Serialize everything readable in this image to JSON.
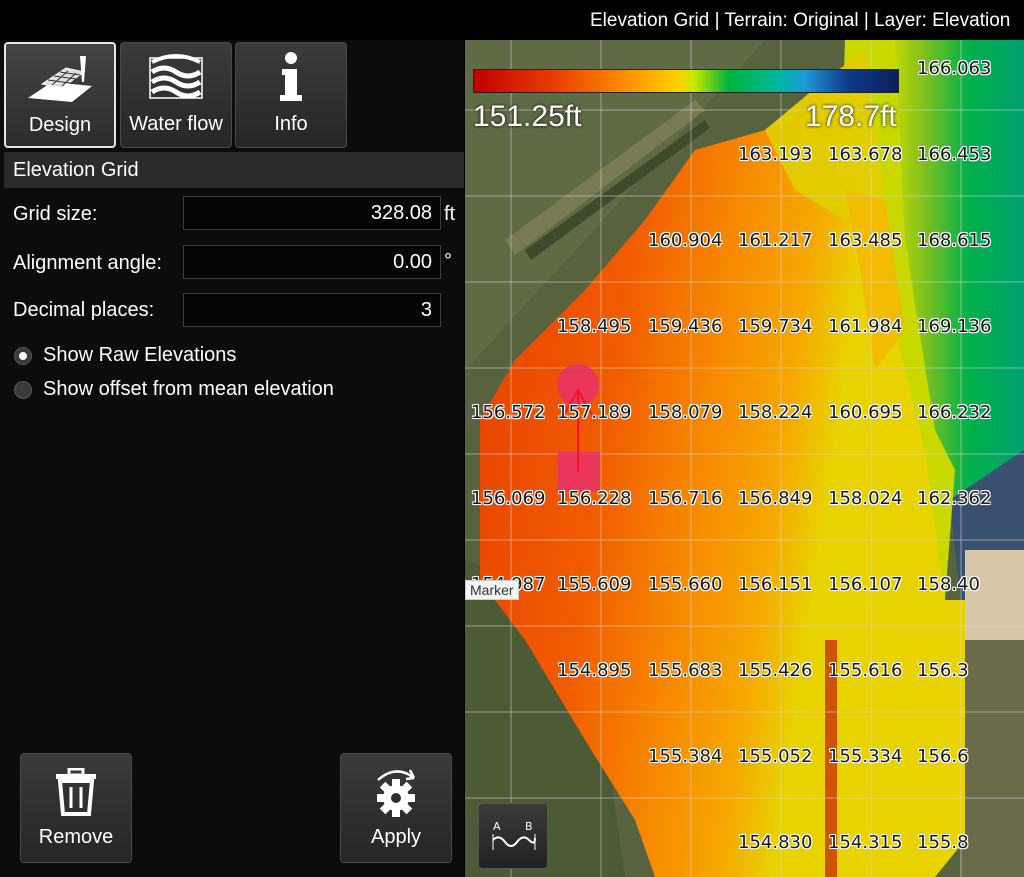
{
  "titlebar": {
    "title": "Elevation Grid | Terrain: Original | Layer: Elevation"
  },
  "tabs": [
    {
      "label": "Design",
      "icon": "design-icon",
      "active": true
    },
    {
      "label": "Water flow",
      "icon": "water-flow-icon",
      "active": false
    },
    {
      "label": "Info",
      "icon": "info-icon",
      "active": false
    }
  ],
  "section": {
    "title": "Elevation Grid"
  },
  "fields": {
    "grid_size": {
      "label": "Grid size:",
      "value": "328.08",
      "unit": "ft"
    },
    "alignment_angle": {
      "label": "Alignment angle:",
      "value": "0.00",
      "unit": "°"
    },
    "decimal_places": {
      "label": "Decimal places:",
      "value": "3"
    }
  },
  "options": {
    "raw": {
      "label": "Show Raw Elevations",
      "selected": true
    },
    "offset": {
      "label": "Show offset from mean elevation",
      "selected": false
    }
  },
  "buttons": {
    "remove": "Remove",
    "apply": "Apply"
  },
  "legend": {
    "min": "151.25ft",
    "max": "178.7ft"
  },
  "map": {
    "marker_label": "Marker",
    "elevation_labels": [
      {
        "text": "166.063",
        "row": 0,
        "col": 5
      },
      {
        "text": "163.193",
        "row": 1,
        "col": 3
      },
      {
        "text": "163.678",
        "row": 1,
        "col": 4
      },
      {
        "text": "166.453",
        "row": 1,
        "col": 5
      },
      {
        "text": "160.904",
        "row": 2,
        "col": 2
      },
      {
        "text": "161.217",
        "row": 2,
        "col": 3
      },
      {
        "text": "163.485",
        "row": 2,
        "col": 4
      },
      {
        "text": "168.615",
        "row": 2,
        "col": 5
      },
      {
        "text": "158.495",
        "row": 3,
        "col": 1
      },
      {
        "text": "159.436",
        "row": 3,
        "col": 2
      },
      {
        "text": "159.734",
        "row": 3,
        "col": 3
      },
      {
        "text": "161.984",
        "row": 3,
        "col": 4
      },
      {
        "text": "169.136",
        "row": 3,
        "col": 5
      },
      {
        "text": "156.572",
        "row": 4,
        "col": 0
      },
      {
        "text": "157.189",
        "row": 4,
        "col": 1
      },
      {
        "text": "158.079",
        "row": 4,
        "col": 2
      },
      {
        "text": "158.224",
        "row": 4,
        "col": 3
      },
      {
        "text": "160.695",
        "row": 4,
        "col": 4
      },
      {
        "text": "166.232",
        "row": 4,
        "col": 5
      },
      {
        "text": "156.069",
        "row": 5,
        "col": 0
      },
      {
        "text": "156.228",
        "row": 5,
        "col": 1
      },
      {
        "text": "156.716",
        "row": 5,
        "col": 2
      },
      {
        "text": "156.849",
        "row": 5,
        "col": 3
      },
      {
        "text": "158.024",
        "row": 5,
        "col": 4
      },
      {
        "text": "162.362",
        "row": 5,
        "col": 5
      },
      {
        "text": "154.987",
        "row": 6,
        "col": 0
      },
      {
        "text": "155.609",
        "row": 6,
        "col": 1
      },
      {
        "text": "155.660",
        "row": 6,
        "col": 2
      },
      {
        "text": "156.151",
        "row": 6,
        "col": 3
      },
      {
        "text": "156.107",
        "row": 6,
        "col": 4
      },
      {
        "text": "158.40",
        "row": 6,
        "col": 5
      },
      {
        "text": "154.895",
        "row": 7,
        "col": 1
      },
      {
        "text": "155.683",
        "row": 7,
        "col": 2
      },
      {
        "text": "155.426",
        "row": 7,
        "col": 3
      },
      {
        "text": "155.616",
        "row": 7,
        "col": 4
      },
      {
        "text": "156.3",
        "row": 7,
        "col": 5
      },
      {
        "text": "155.384",
        "row": 8,
        "col": 2
      },
      {
        "text": "155.052",
        "row": 8,
        "col": 3
      },
      {
        "text": "155.334",
        "row": 8,
        "col": 4
      },
      {
        "text": "156.6",
        "row": 8,
        "col": 5
      },
      {
        "text": "154.830",
        "row": 9,
        "col": 3
      },
      {
        "text": "154.315",
        "row": 9,
        "col": 4
      },
      {
        "text": "155.8",
        "row": 9,
        "col": 5
      }
    ]
  },
  "icons": {
    "design": "design-icon",
    "water_flow": "water-flow-icon",
    "info": "info-icon",
    "remove": "trash-icon",
    "apply": "gear-refresh-icon",
    "profile": "ab-profile-icon"
  }
}
